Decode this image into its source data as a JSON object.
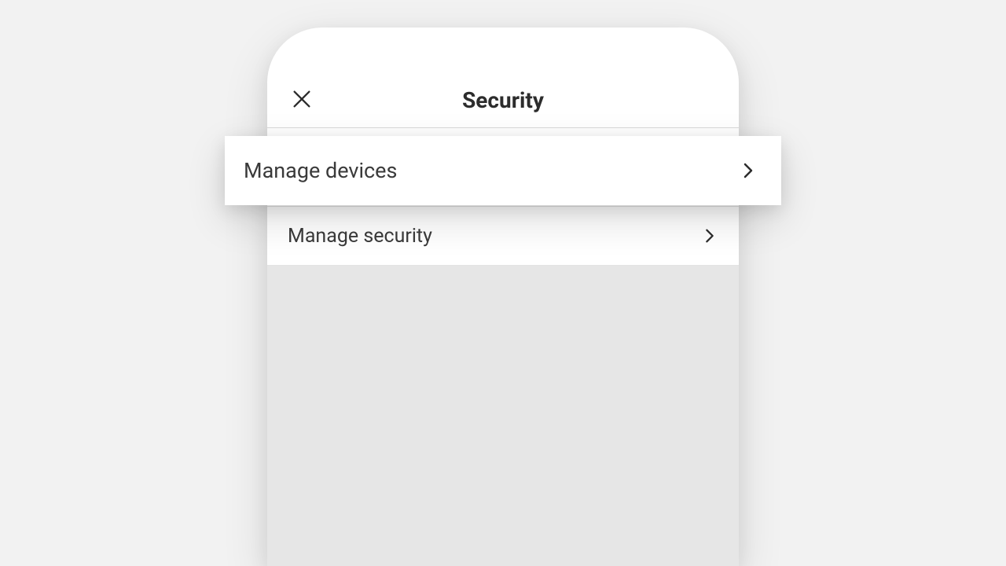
{
  "header": {
    "title": "Security"
  },
  "rows": [
    {
      "label": "Manage devices"
    },
    {
      "label": "Manage security"
    }
  ],
  "colors": {
    "background": "#f2f2f2",
    "panel_bg": "#e6e6e6",
    "surface": "#ffffff",
    "text": "#2c2c2c",
    "divider": "#e3e3e3"
  }
}
